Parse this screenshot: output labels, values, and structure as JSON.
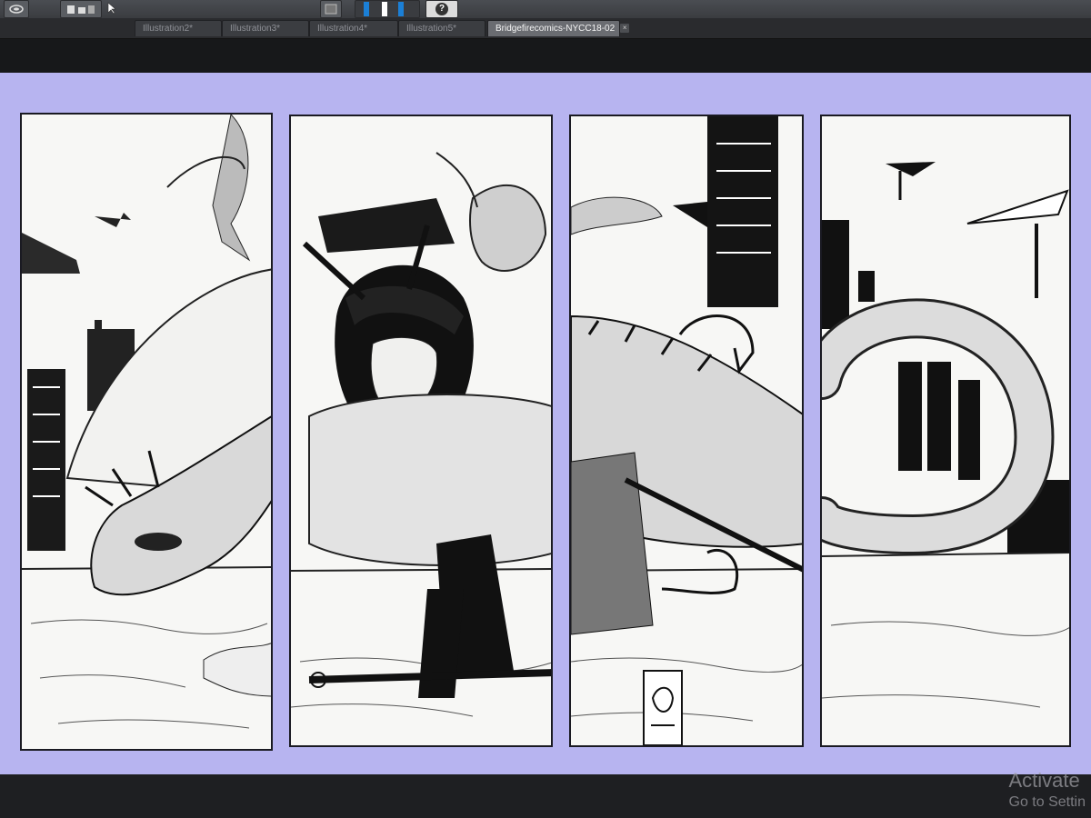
{
  "toolbar": {
    "help_label": "?"
  },
  "tabs": [
    {
      "label": "Illustration2*",
      "active": false
    },
    {
      "label": "Illustration3*",
      "active": false
    },
    {
      "label": "Illustration4*",
      "active": false
    },
    {
      "label": "Illustration5*",
      "active": false
    },
    {
      "label": "Bridgefirecomics-NYCC18-02",
      "active": true
    }
  ],
  "tab_close_label": "×",
  "watermark": {
    "line1": "Activate",
    "line2": "Go to Settin"
  },
  "colors": {
    "canvas_background": "#b7b4f0",
    "panel_background": "#f7f7f5",
    "ink": "#1a1a22"
  }
}
